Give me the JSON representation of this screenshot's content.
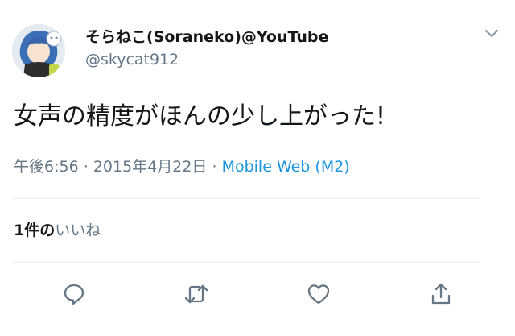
{
  "author": {
    "display_name": "そらねこ(Soraneko)@YouTube",
    "handle": "@skycat912"
  },
  "tweet": {
    "text": "女声の精度がほんの少し上がった!",
    "time": "午後6:56",
    "date": "2015年4月22日",
    "separator": "·",
    "source": "Mobile Web (M2)"
  },
  "likes": {
    "count": "1件の",
    "label": "いいね"
  },
  "icons": {
    "caret": "chevron-down-icon",
    "reply": "reply-icon",
    "retweet": "retweet-icon",
    "like": "heart-icon",
    "share": "share-icon"
  },
  "colors": {
    "text": "#14171a",
    "secondary": "#657786",
    "link": "#1b95e0",
    "divider": "#e6ecf0"
  }
}
